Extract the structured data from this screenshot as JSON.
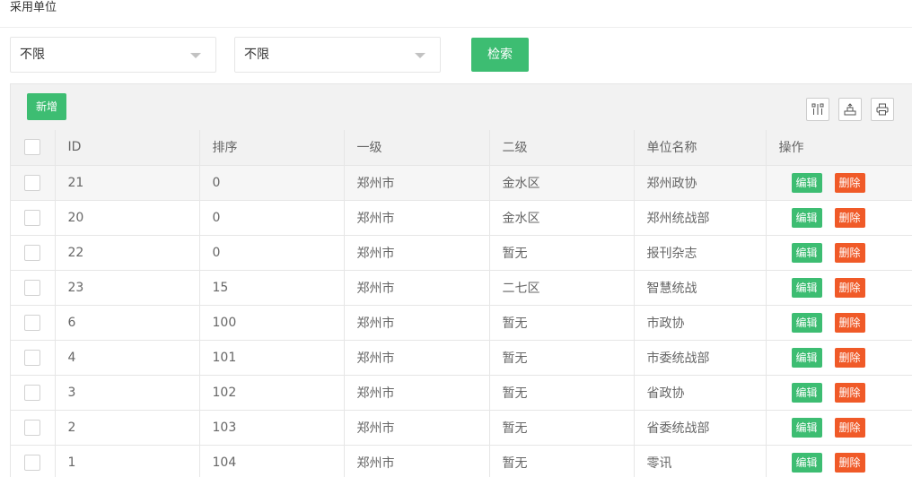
{
  "page": {
    "title": "采用单位"
  },
  "filters": {
    "level1": {
      "value": "不限"
    },
    "level2": {
      "value": "不限"
    },
    "search_label": "检索"
  },
  "toolbar": {
    "add_label": "新增",
    "icons": [
      "columns-icon",
      "export-icon",
      "print-icon"
    ]
  },
  "table": {
    "headers": [
      "ID",
      "排序",
      "一级",
      "二级",
      "单位名称",
      "操作"
    ],
    "edit_label": "编辑",
    "delete_label": "删除",
    "rows": [
      {
        "id": "21",
        "sort": "0",
        "level1": "郑州市",
        "level2": "金水区",
        "name": "郑州政协"
      },
      {
        "id": "20",
        "sort": "0",
        "level1": "郑州市",
        "level2": "金水区",
        "name": "郑州统战部"
      },
      {
        "id": "22",
        "sort": "0",
        "level1": "郑州市",
        "level2": "暂无",
        "name": "报刊杂志"
      },
      {
        "id": "23",
        "sort": "15",
        "level1": "郑州市",
        "level2": "二七区",
        "name": "智慧统战"
      },
      {
        "id": "6",
        "sort": "100",
        "level1": "郑州市",
        "level2": "暂无",
        "name": "市政协"
      },
      {
        "id": "4",
        "sort": "101",
        "level1": "郑州市",
        "level2": "暂无",
        "name": "市委统战部"
      },
      {
        "id": "3",
        "sort": "102",
        "level1": "郑州市",
        "level2": "暂无",
        "name": "省政协"
      },
      {
        "id": "2",
        "sort": "103",
        "level1": "郑州市",
        "level2": "暂无",
        "name": "省委统战部"
      },
      {
        "id": "1",
        "sort": "104",
        "level1": "郑州市",
        "level2": "暂无",
        "name": "零讯"
      }
    ]
  },
  "colors": {
    "primary": "#3dbd72",
    "danger": "#f05a28",
    "border": "#e6e6e6",
    "header_bg": "#f2f2f2"
  }
}
